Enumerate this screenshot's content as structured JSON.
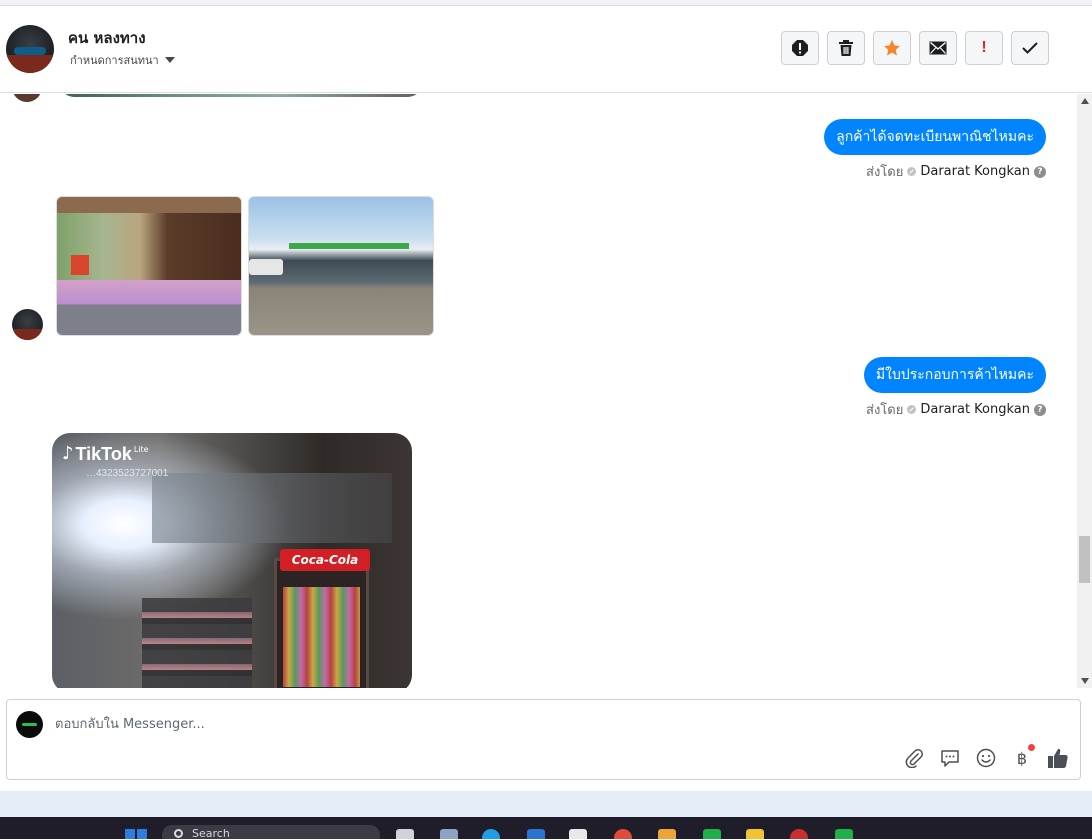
{
  "header": {
    "contact_name": "คน หลงทาง",
    "assign_label": "กำหนดการสนทนา",
    "actions": [
      {
        "name": "spam-button",
        "icon": "alert-octagon-icon"
      },
      {
        "name": "delete-button",
        "icon": "trash-icon"
      },
      {
        "name": "star-button",
        "icon": "star-icon",
        "color": "#f5862e"
      },
      {
        "name": "mark-unread-button",
        "icon": "envelope-icon"
      },
      {
        "name": "follow-up-button",
        "icon": "exclamation-icon",
        "label": "!",
        "color": "#e4262b"
      },
      {
        "name": "mark-done-button",
        "icon": "check-icon"
      }
    ]
  },
  "messages": {
    "m1": {
      "text": "ลูกค้าได้จดทะเบียนพาณิชไหมคะ",
      "sent_by_prefix": "ส่งโดย",
      "agent": "Dararat Kongkan",
      "help": "?"
    },
    "photos": [
      "shop-photo-1",
      "shop-photo-2"
    ],
    "m2": {
      "text": "มีใบประกอบการค้าไหมคะ",
      "sent_by_prefix": "ส่งโดย",
      "agent": "Dararat Kongkan",
      "help": "?"
    },
    "video": {
      "brand": "TikTok",
      "brand_suffix": "Lite",
      "id": "…4323523727001",
      "sign": "Coca-Cola"
    }
  },
  "composer": {
    "placeholder": "ตอบกลับใน Messenger...",
    "tools": [
      "paperclip-icon",
      "chat-bubble-icon",
      "smile-icon",
      "baht-icon",
      "thumbs-up-icon"
    ],
    "baht_symbol": "฿",
    "accent_color": "#0084ff"
  },
  "taskbar": {
    "search_text": "Search"
  }
}
